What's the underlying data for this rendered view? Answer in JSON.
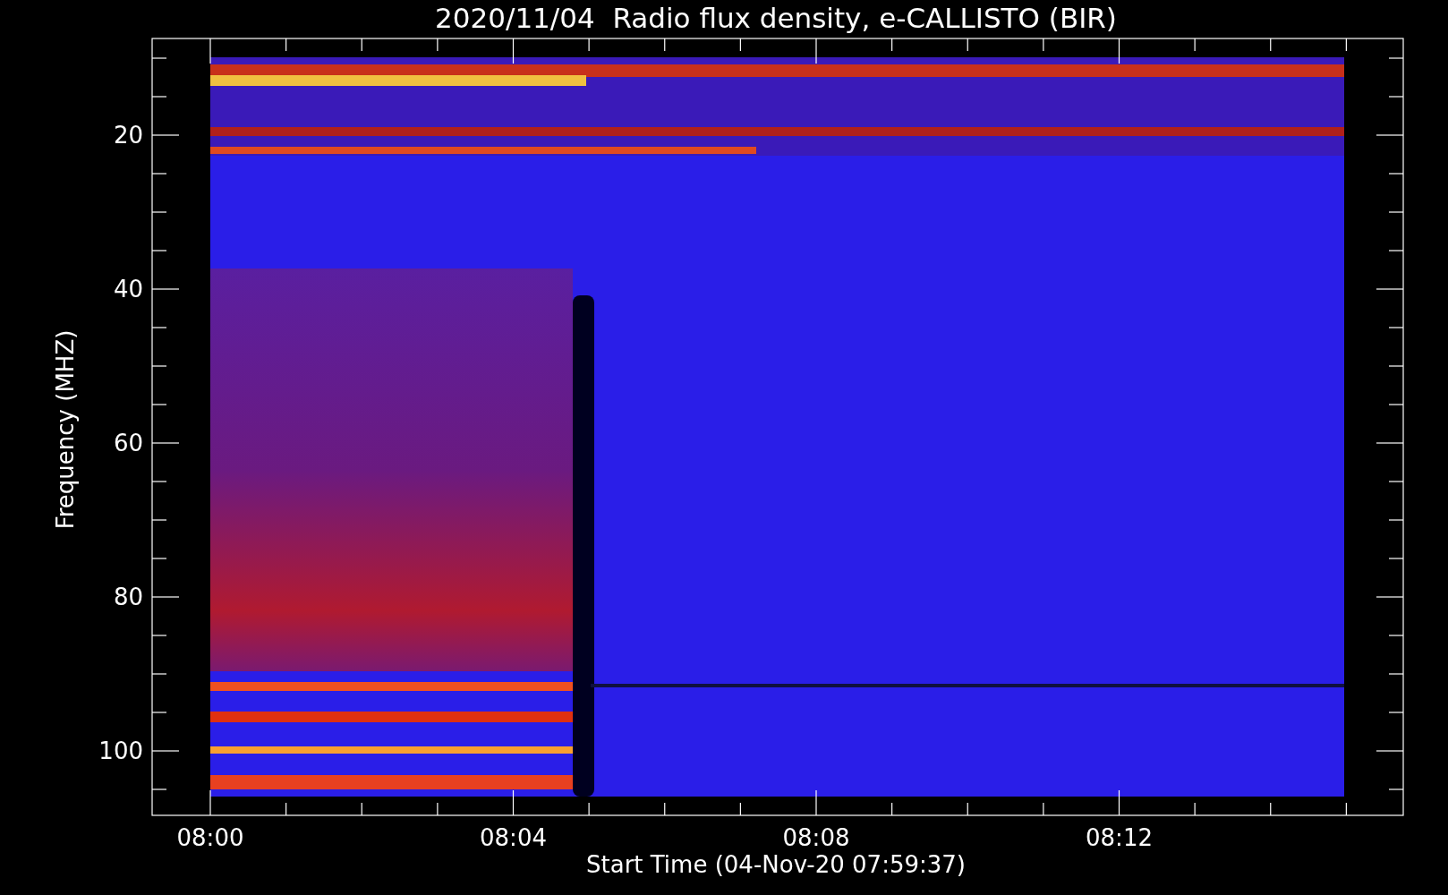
{
  "title": "2020/11/04  Radio flux density, e-CALLISTO (BIR)",
  "y_axis": {
    "label": "Frequency (MHZ)",
    "tick_labels": [
      "20",
      "40",
      "60",
      "80",
      "100"
    ]
  },
  "x_axis": {
    "label": "Start Time (04-Nov-20 07:59:37)",
    "tick_labels": [
      "08:00",
      "08:04",
      "08:08",
      "08:12"
    ]
  }
}
